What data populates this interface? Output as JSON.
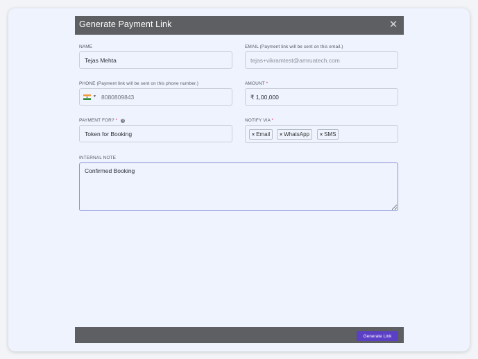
{
  "modal": {
    "title": "Generate Payment Link",
    "close_icon": "close-icon"
  },
  "form": {
    "name": {
      "label": "NAME",
      "value": "Tejas Mehta"
    },
    "email": {
      "label": "EMAIL",
      "label_note": " (Payment link will be sent on this email.)",
      "placeholder": "tejas+vikramtest@amruatech.com"
    },
    "phone": {
      "label": "PHONE",
      "label_note": " (Payment link will be sent on this phone number.)",
      "country_icon": "india-flag-icon",
      "value": "8080809843"
    },
    "amount": {
      "label": "AMOUNT",
      "required": "*",
      "value": "₹ 1,00,000"
    },
    "payment_for": {
      "label": "PAYMENT FOR?",
      "required": "*",
      "info_icon": "info-icon",
      "info_glyph": "i",
      "value": "Token for Booking"
    },
    "notify_via": {
      "label": "NOTIFY VIA",
      "required": "*",
      "remove_glyph": "×",
      "chips": [
        "Email",
        "WhatsApp",
        "SMS"
      ]
    },
    "internal_note": {
      "label": "INTERNAL NOTE",
      "value": "Confirmed Booking"
    }
  },
  "footer": {
    "generate_label": "Generate Link"
  },
  "colors": {
    "header_bg": "#5e5f62",
    "accent": "#5b3fc4",
    "required": "#e0245e"
  }
}
